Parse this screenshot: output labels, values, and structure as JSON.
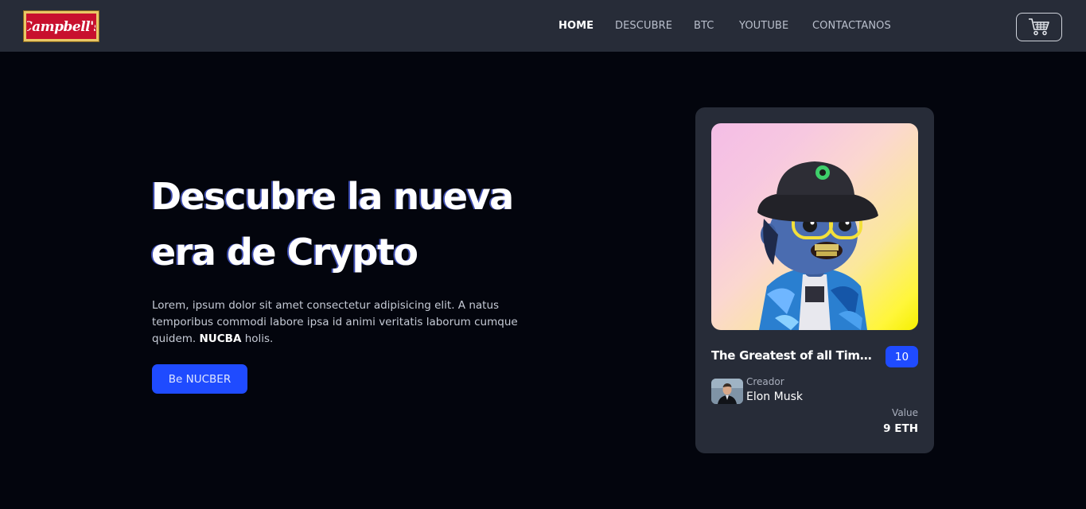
{
  "header": {
    "logo_text": "Campbell's",
    "nav": [
      {
        "label": "HOME",
        "active": true
      },
      {
        "label": "DESCUBRE",
        "active": false
      },
      {
        "label": "BTC",
        "active": false
      },
      {
        "label": "YOUTUBE",
        "active": false
      },
      {
        "label": "CONTACTANOS",
        "active": false
      }
    ],
    "cart_icon": "shopping-cart-icon"
  },
  "hero": {
    "title_line1": "Descubre la nueva",
    "title_line2": "era de Crypto",
    "description": "Lorem, ipsum dolor sit amet consectetur adipisicing elit. A natus temporibus commodi labore ipsa id animi veritatis laborum cumque quidem.",
    "description_bold": "NUCBA",
    "description_end": "holis.",
    "cta_label": "Be NUCBER"
  },
  "card": {
    "title": "The Greatest of all Time ...",
    "badge": "10",
    "creator_label": "Creador",
    "creator_name": "Elon Musk",
    "value_label": "Value",
    "value_amount": "9 ETH"
  },
  "colors": {
    "background": "#03050d",
    "header": "#272c38",
    "card": "#272c38",
    "accent": "#1f4bff",
    "logo_red": "#c8102e",
    "logo_gold": "#e8c766"
  }
}
